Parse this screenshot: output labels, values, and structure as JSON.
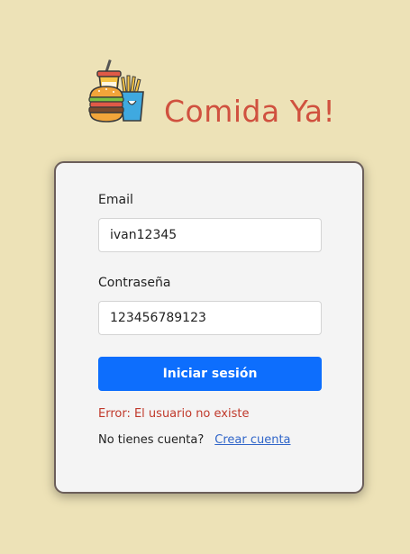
{
  "app": {
    "title": "Comida Ya!",
    "logo_icon": "fast-food-icon"
  },
  "form": {
    "email_label": "Email",
    "email_value": "ivan12345",
    "password_label": "Contraseña",
    "password_value": "123456789123",
    "login_button": "Iniciar sesión",
    "error_message": "Error: El usuario no existe",
    "register_prompt": "No tienes cuenta?",
    "register_link": "Crear cuenta"
  },
  "colors": {
    "background": "#ede2b7",
    "brand": "#d0513f",
    "primary": "#0d6efd",
    "error": "#c0392b",
    "link": "#2f65c9"
  }
}
